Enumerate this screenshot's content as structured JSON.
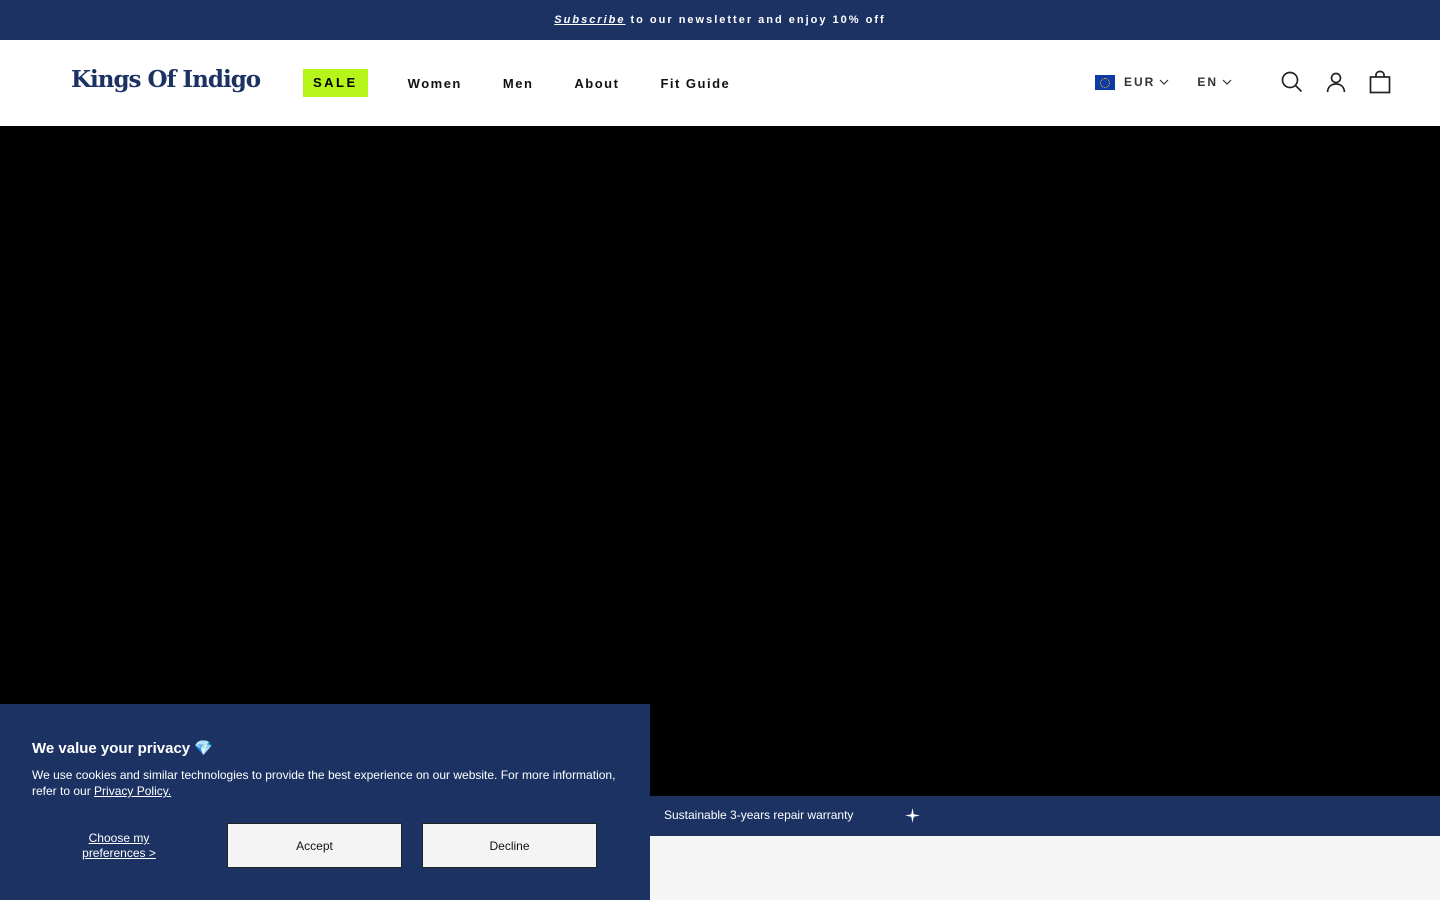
{
  "announcement": {
    "link": "Subscribe",
    "text": "to our newsletter and enjoy 10% off"
  },
  "header": {
    "logo": "Kings Of Indigo",
    "nav": {
      "sale": "SALE",
      "women": "Women",
      "men": "Men",
      "about": "About",
      "fit_guide": "Fit Guide"
    },
    "currency": "EUR",
    "language": "EN",
    "icons": [
      "search-icon",
      "account-icon",
      "bag-icon"
    ]
  },
  "strip": {
    "text": "Sustainable 3-years repair warranty"
  },
  "cookie": {
    "title": "We value your privacy 💎",
    "body": "We use cookies and similar technologies to provide the best experience on our website. For more information, refer to our",
    "policy_link": "Privacy Policy.",
    "prefs": "Choose my preferences >",
    "accept": "Accept",
    "decline": "Decline"
  },
  "colors": {
    "navy": "#1b3263",
    "sale_green": "#b5f51a",
    "hero": "#000000"
  }
}
